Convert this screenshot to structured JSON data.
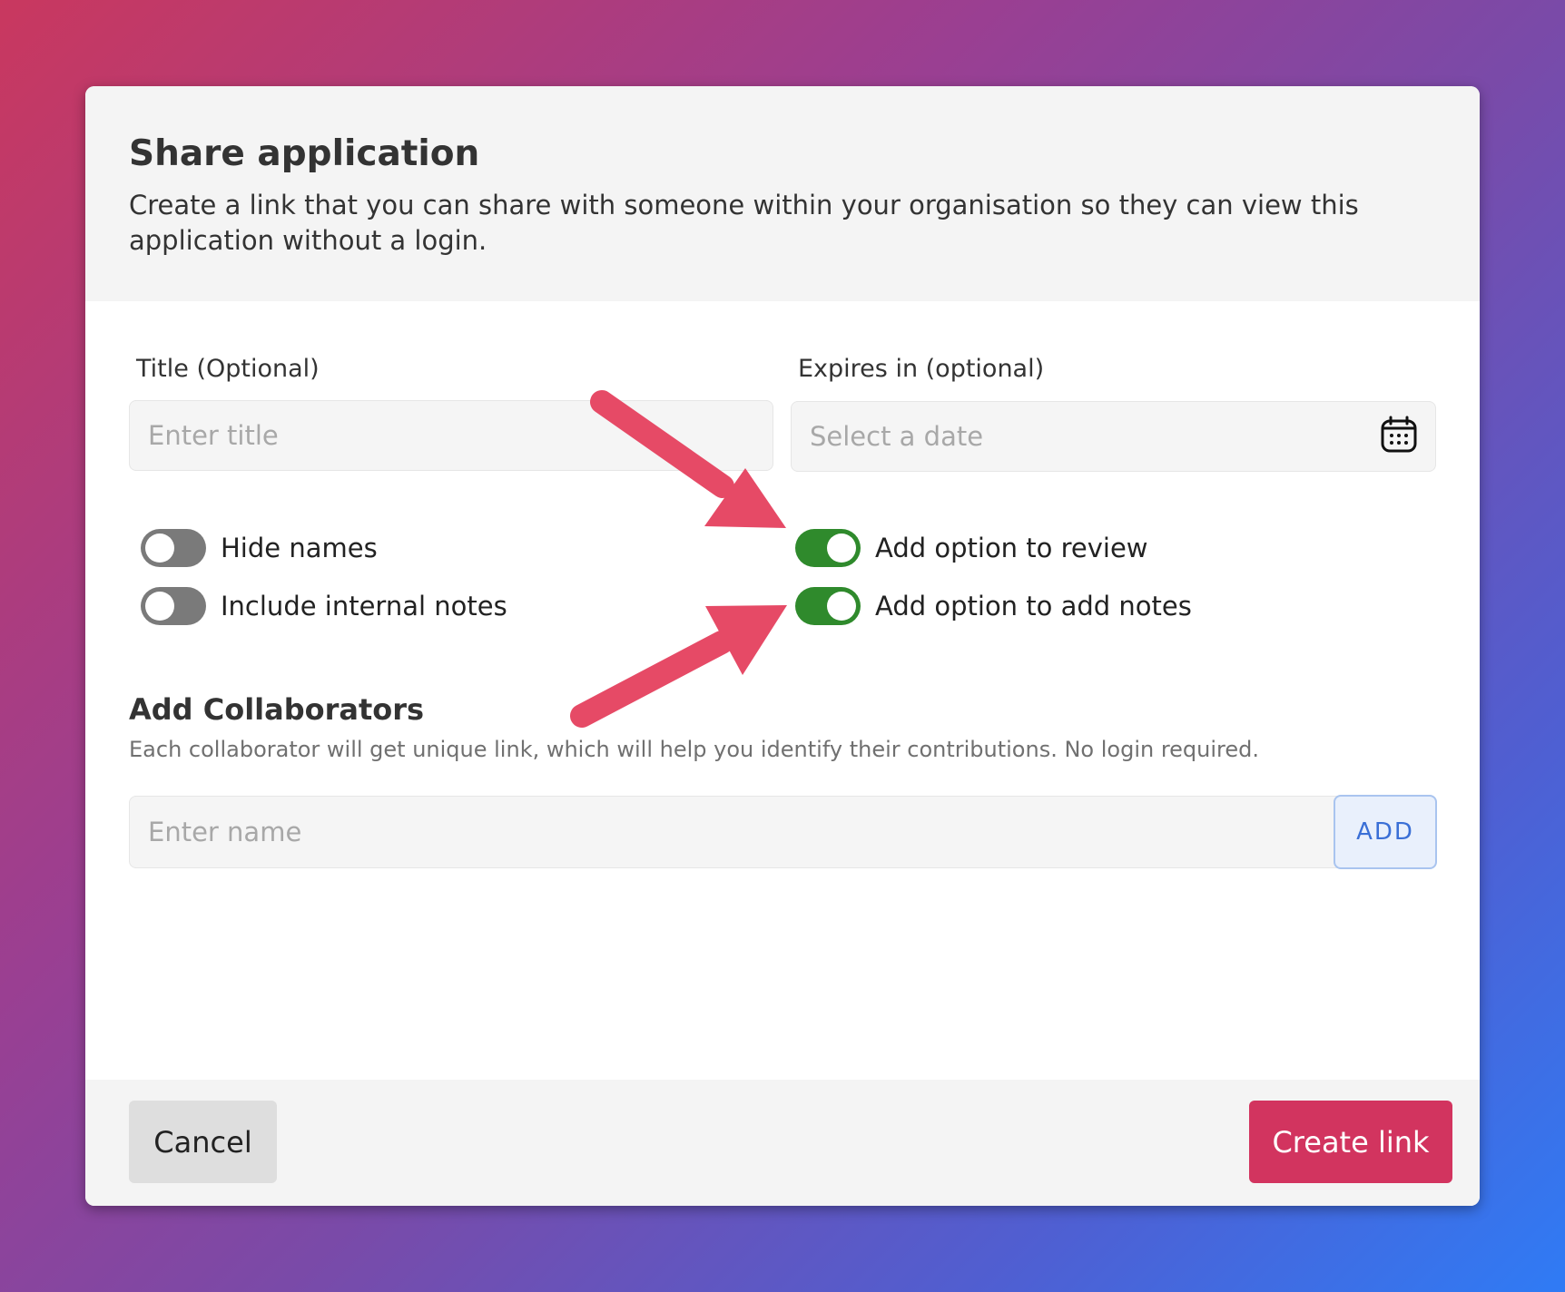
{
  "dialog": {
    "title": "Share application",
    "description": "Create a link that you can share with someone within your organisation so they can view this application without a login."
  },
  "form": {
    "title_label": "Title (Optional)",
    "title_placeholder": "Enter title",
    "expires_label": "Expires in (optional)",
    "expires_placeholder": "Select a date",
    "calendar_icon": "calendar-icon"
  },
  "toggles": {
    "hide_names": {
      "label": "Hide names",
      "on": false
    },
    "include_internal_notes": {
      "label": "Include internal notes",
      "on": false
    },
    "add_option_to_review": {
      "label": "Add option to review",
      "on": true
    },
    "add_option_to_add_notes": {
      "label": "Add option to add notes",
      "on": true
    }
  },
  "collaborators": {
    "title": "Add Collaborators",
    "description": "Each collaborator will get unique link, which will help you identify their contributions. No login required.",
    "name_placeholder": "Enter name",
    "add_label": "ADD"
  },
  "footer": {
    "cancel_label": "Cancel",
    "create_label": "Create link"
  },
  "colors": {
    "toggle_on": "#2f8a2c",
    "toggle_off": "#7a7a7a",
    "primary": "#d2345f",
    "annotation_arrow": "#e64a66",
    "add_button_text": "#3a6fd6"
  }
}
